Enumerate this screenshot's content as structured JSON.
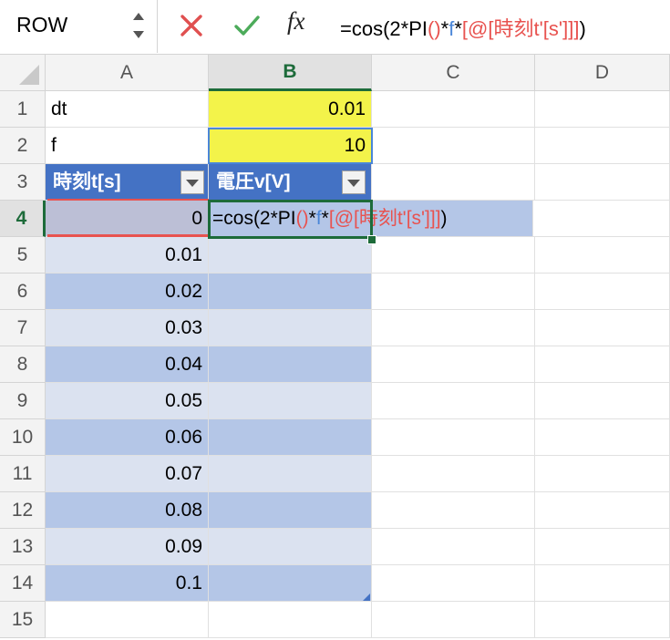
{
  "formula_bar": {
    "name_box": "ROW",
    "cancel_icon": "cross-icon",
    "enter_icon": "checkmark-icon",
    "fx_label": "fx",
    "formula_parts": [
      {
        "text": "=cos(2*PI",
        "color": "#000000"
      },
      {
        "text": "()",
        "color": "#e8524f"
      },
      {
        "text": "*",
        "color": "#000000"
      },
      {
        "text": "f",
        "color": "#4a86d8"
      },
      {
        "text": "*",
        "color": "#000000"
      },
      {
        "text": "[@[時刻t'[s']]]",
        "color": "#e8524f"
      },
      {
        "text": ")",
        "color": "#000000"
      }
    ]
  },
  "columns": [
    "A",
    "B",
    "C",
    "D"
  ],
  "active_column": "B",
  "rows": [
    "1",
    "2",
    "3",
    "4",
    "5",
    "6",
    "7",
    "8",
    "9",
    "10",
    "11",
    "12",
    "13",
    "14",
    "15"
  ],
  "active_row": "4",
  "cells": {
    "A1": "dt",
    "B1": "0.01",
    "A2": "f",
    "B2": "10",
    "A3": "時刻t[s]",
    "B3": "電圧v[V]",
    "A4": "0",
    "B4_editing": [
      {
        "text": "=cos(2*PI",
        "color": "#000000"
      },
      {
        "text": "()",
        "color": "#e8524f"
      },
      {
        "text": "*",
        "color": "#000000"
      },
      {
        "text": "f",
        "color": "#4a86d8"
      },
      {
        "text": "*",
        "color": "#000000"
      },
      {
        "text": "[@[時刻t'[s']]]",
        "color": "#e8524f"
      },
      {
        "text": ")",
        "color": "#000000"
      }
    ]
  },
  "time_values": [
    "0.01",
    "0.02",
    "0.03",
    "0.04",
    "0.05",
    "0.06",
    "0.07",
    "0.08",
    "0.09",
    "0.1"
  ],
  "colors": {
    "input_yellow": "#f3f34a",
    "table_header": "#4472c4",
    "band_light": "#dbe2f0",
    "band_dark": "#b4c6e7",
    "active_green": "#1d6b3a",
    "ref_red": "#e8524f",
    "ref_blue": "#4a86d8"
  }
}
